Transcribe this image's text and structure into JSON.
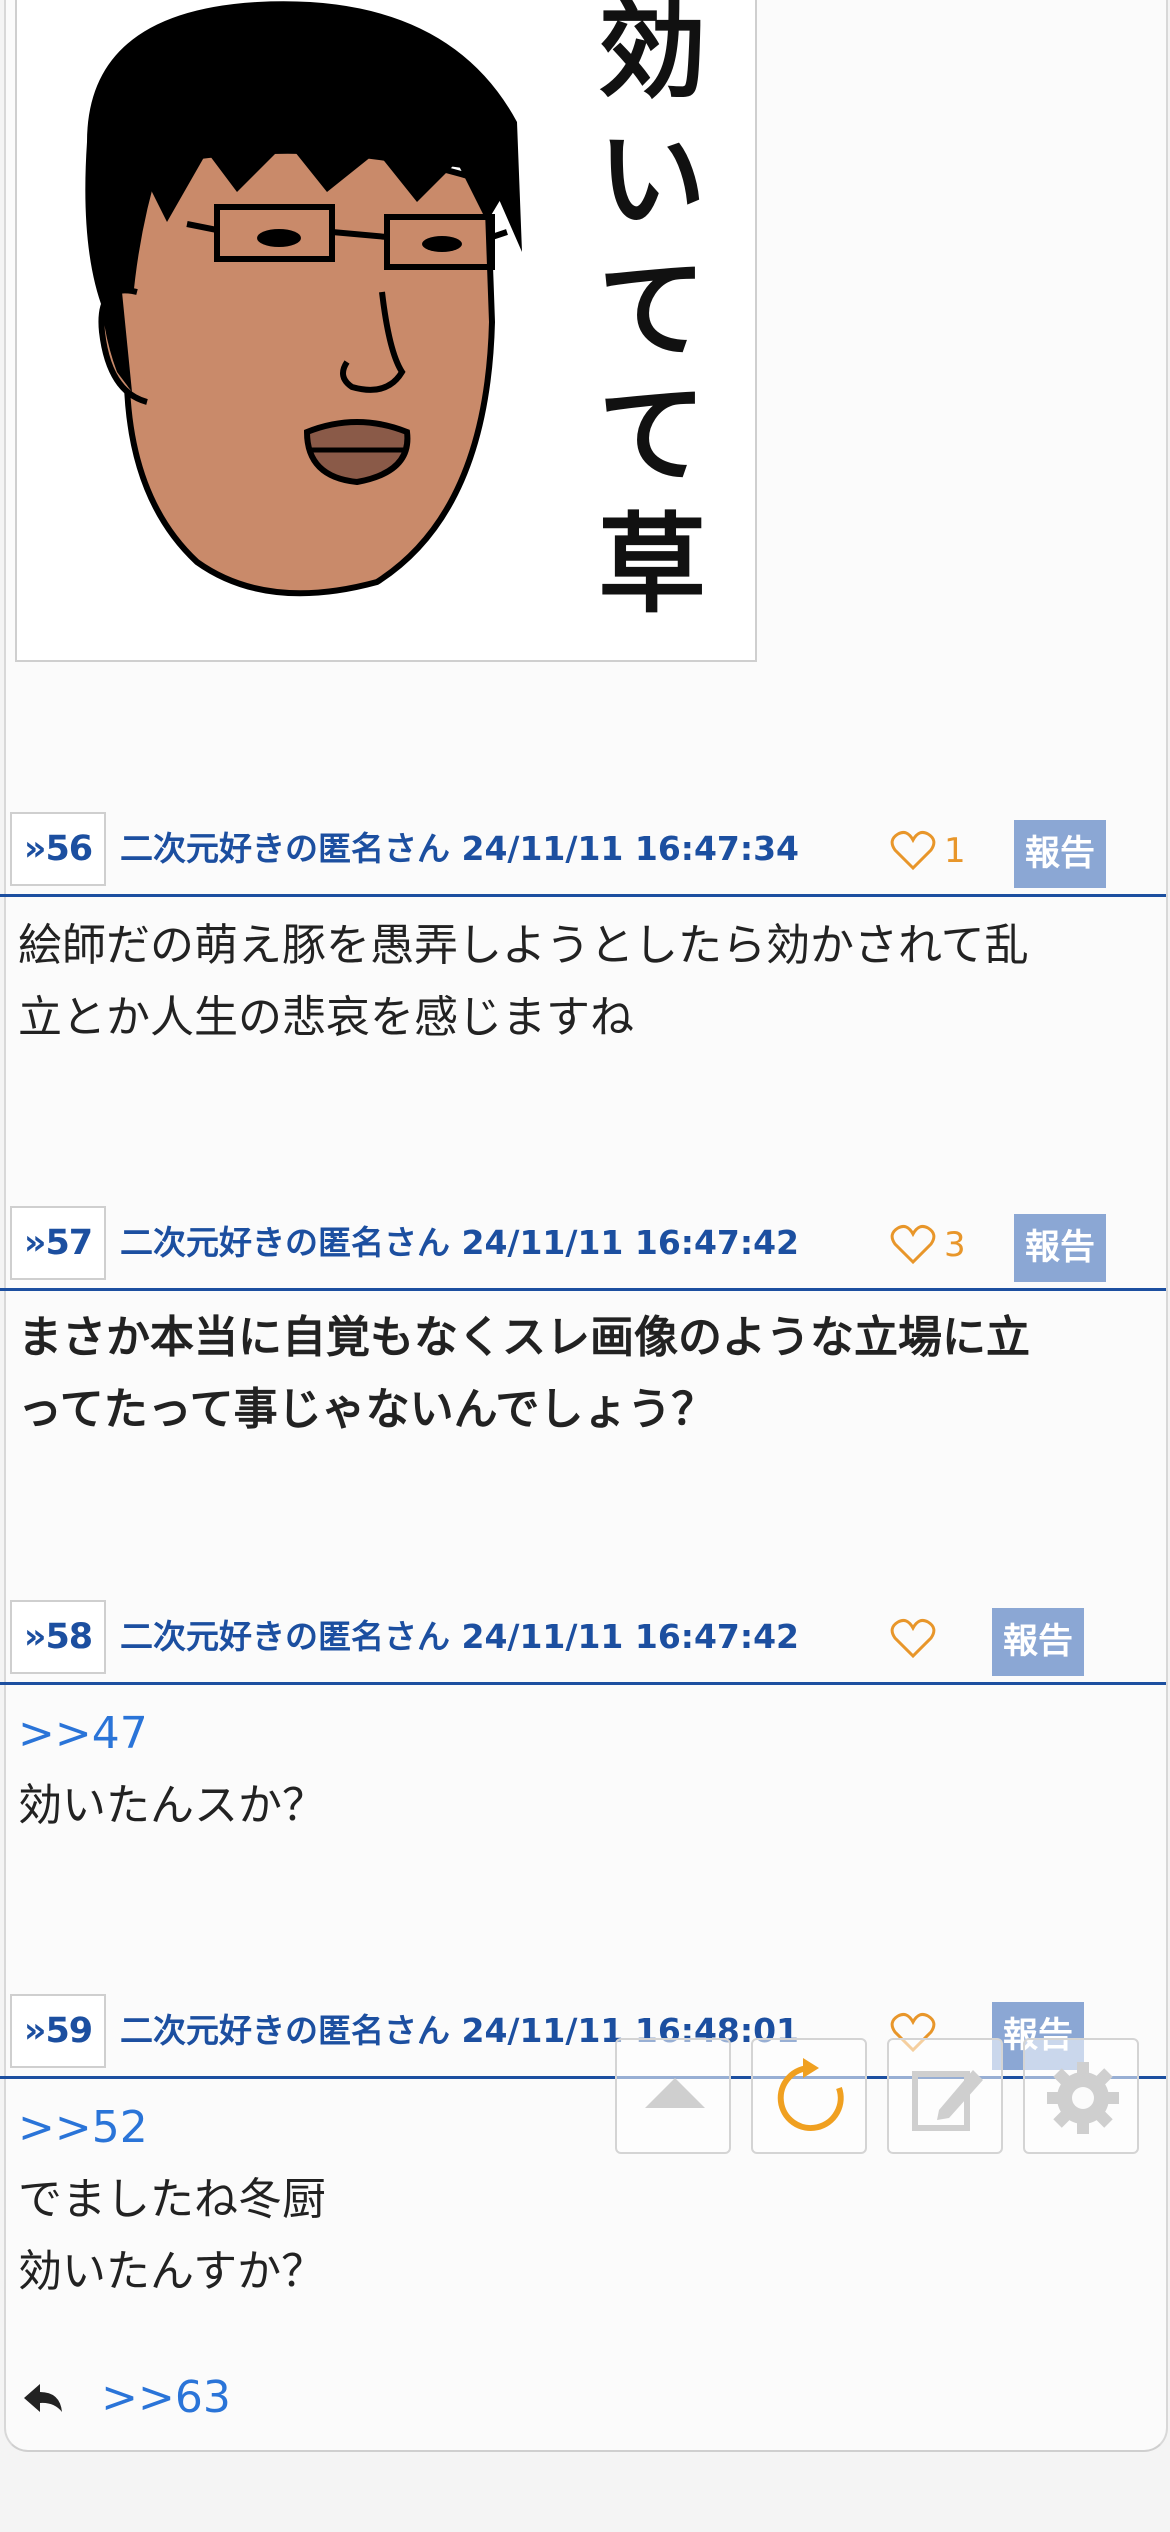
{
  "thread_image": {
    "alt_text": "効いてて草"
  },
  "posts": [
    {
      "number": "»56",
      "meta": "二次元好きの匿名さん 24/11/11 16:47:34",
      "likes": "1",
      "report_label": "報告",
      "lines": [
        "絵師だの萌え豚を愚弄しようとしたら効かされて乱",
        "立とか人生の悲哀を感じますね"
      ]
    },
    {
      "number": "»57",
      "meta": "二次元好きの匿名さん 24/11/11 16:47:42",
      "likes": "3",
      "report_label": "報告",
      "lines": [
        "まさか本当に自覚もなくスレ画像のような立場に立",
        "ってたって事じゃないんでしょう？"
      ]
    },
    {
      "number": "»58",
      "meta": "二次元好きの匿名さん 24/11/11 16:47:42",
      "likes": "",
      "report_label": "報告",
      "anchor": ">>47",
      "lines": [
        "効いたんスか？"
      ]
    },
    {
      "number": "»59",
      "meta": "二次元好きの匿名さん 24/11/11 16:48:01",
      "likes": "",
      "report_label": "報告",
      "anchor": ">>52",
      "lines": [
        "でましたね冬厨",
        "効いたんすか？"
      ]
    }
  ],
  "replies": {
    "icon": "reply-arrow-icon",
    "anchor": ">>63"
  },
  "floating_toolbar": {
    "buttons": [
      "scroll-top-icon",
      "reload-icon",
      "compose-icon",
      "gear-icon"
    ]
  },
  "colors": {
    "accent_blue": "#1c4fa0",
    "link_blue": "#2a74d8",
    "like_orange": "#e8962a",
    "report_bg": "#8ba7d4"
  }
}
